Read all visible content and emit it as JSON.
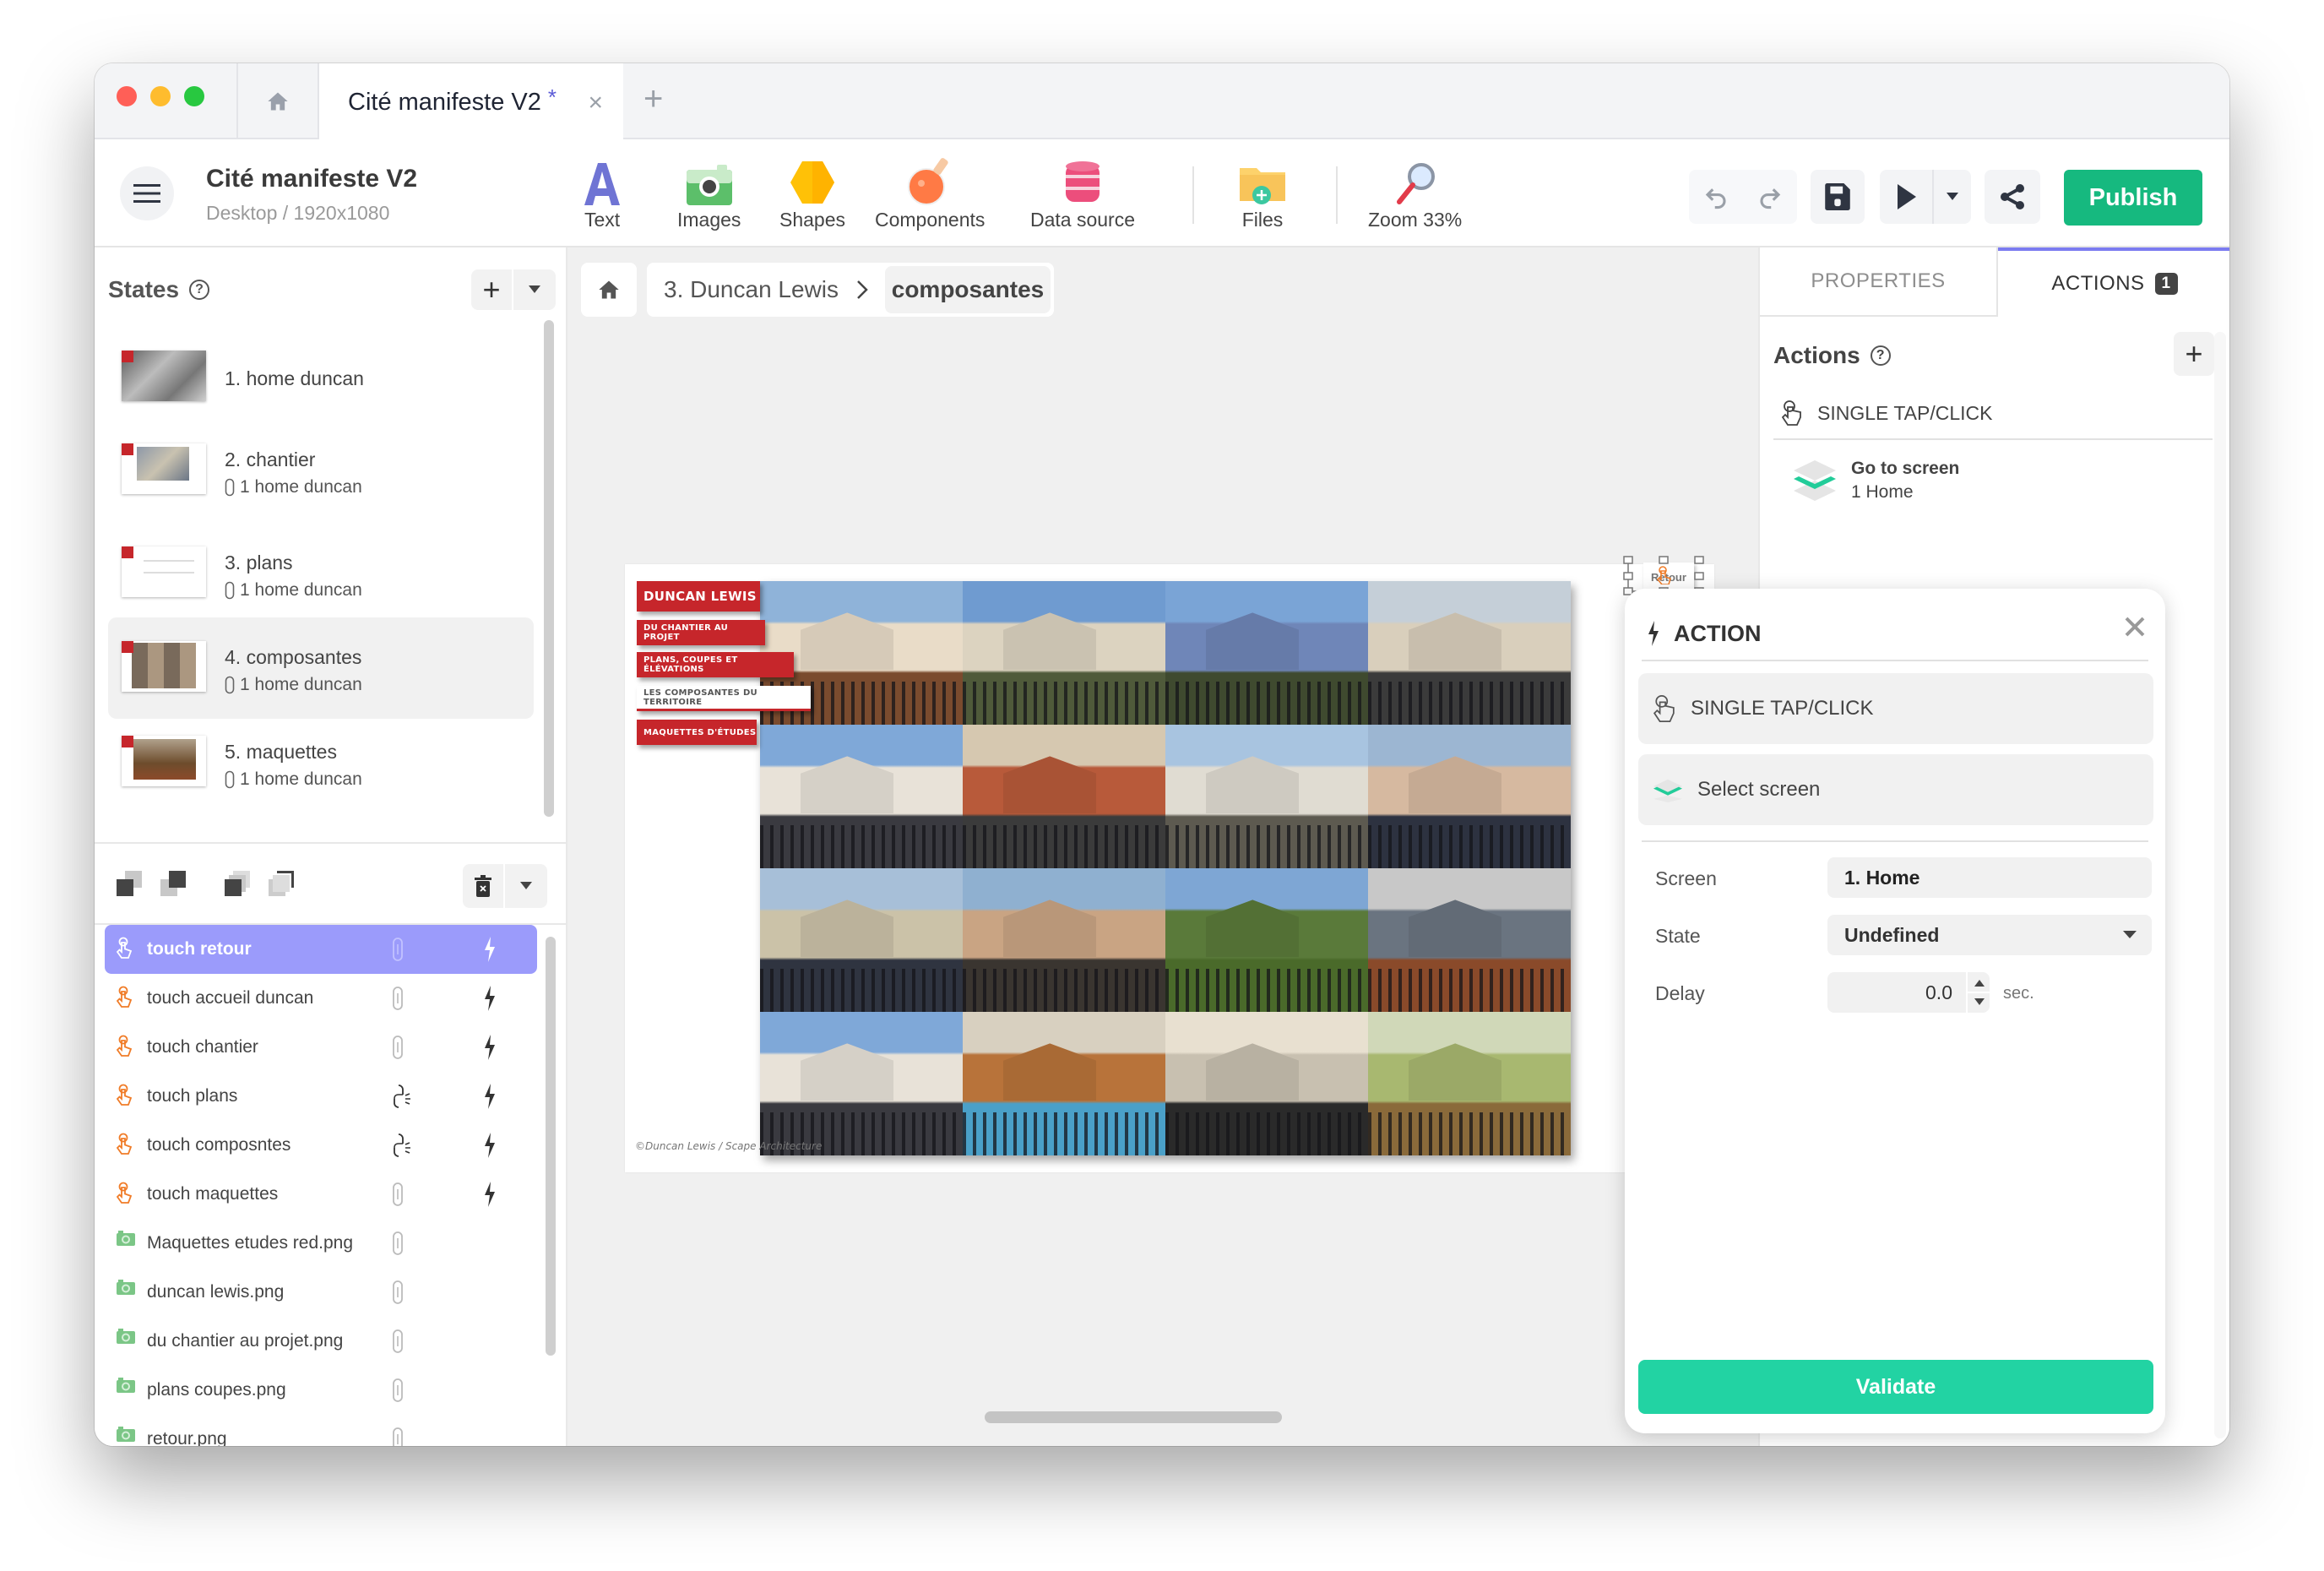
{
  "window": {
    "traffic_lights": {
      "close": "#ff5f57",
      "minimize": "#febc2e",
      "zoom": "#28c840"
    },
    "tabs": [
      {
        "label": "Cité manifeste V2",
        "modified_marker": "*",
        "active": true
      }
    ],
    "tab_close": "×",
    "tab_add": "+"
  },
  "toolbar": {
    "project_title": "Cité manifeste V2",
    "project_subtitle": "Desktop / 1920x1080",
    "tools": [
      {
        "label": "Text",
        "icon": "text-icon"
      },
      {
        "label": "Images",
        "icon": "camera-icon"
      },
      {
        "label": "Shapes",
        "icon": "hexagon-icon"
      },
      {
        "label": "Components",
        "icon": "flask-icon"
      },
      {
        "label": "Data source",
        "icon": "database-icon"
      },
      {
        "label": "Files",
        "icon": "folder-add-icon"
      },
      {
        "label": "Zoom 33%",
        "icon": "magnifier-icon"
      }
    ],
    "publish_label": "Publish",
    "colors": {
      "publish": "#16b97f",
      "accent": "#7b7bf0"
    }
  },
  "states_panel": {
    "title": "States",
    "items": [
      {
        "name": "1. home duncan",
        "link": null,
        "selected": false
      },
      {
        "name": "2. chantier",
        "link": "1  home duncan",
        "selected": false
      },
      {
        "name": "3. plans",
        "link": "1  home duncan",
        "selected": false
      },
      {
        "name": "4. composantes",
        "link": "1  home duncan",
        "selected": true
      },
      {
        "name": "5. maquettes",
        "link": "1  home duncan",
        "selected": false
      }
    ]
  },
  "layers": {
    "items": [
      {
        "name": "touch retour",
        "type": "hotspot",
        "link": "linked",
        "action": true,
        "selected": true
      },
      {
        "name": "touch accueil duncan",
        "type": "hotspot",
        "link": "linked",
        "action": true,
        "selected": false
      },
      {
        "name": "touch chantier",
        "type": "hotspot",
        "link": "linked",
        "action": true,
        "selected": false
      },
      {
        "name": "touch plans",
        "type": "hotspot",
        "link": "unlinked",
        "action": true,
        "selected": false
      },
      {
        "name": "touch composntes",
        "type": "hotspot",
        "link": "unlinked",
        "action": true,
        "selected": false
      },
      {
        "name": "touch maquettes",
        "type": "hotspot",
        "link": "linked",
        "action": true,
        "selected": false
      },
      {
        "name": "Maquettes etudes red.png",
        "type": "image",
        "link": "linked",
        "action": false,
        "selected": false
      },
      {
        "name": "duncan lewis.png",
        "type": "image",
        "link": "linked",
        "action": false,
        "selected": false
      },
      {
        "name": "du chantier au projet.png",
        "type": "image",
        "link": "linked",
        "action": false,
        "selected": false
      },
      {
        "name": "plans coupes.png",
        "type": "image",
        "link": "linked",
        "action": false,
        "selected": false
      },
      {
        "name": "retour.png",
        "type": "image",
        "link": "linked",
        "action": false,
        "selected": false
      }
    ]
  },
  "breadcrumb": {
    "items": [
      "3. Duncan Lewis",
      "composantes"
    ],
    "separator": "›"
  },
  "artboard": {
    "menu": [
      {
        "label": "DUNCAN LEWIS",
        "style": "red"
      },
      {
        "label": "DU CHANTIER AU PROJET",
        "style": "red"
      },
      {
        "label": "PLANS, COUPES ET ÉLÉVATIONS",
        "style": "red"
      },
      {
        "label": "LES COMPOSANTES DU TERRITOIRE",
        "style": "white"
      },
      {
        "label": "MAQUETTES D'ÉTUDES",
        "style": "red"
      }
    ],
    "copyright": "©Duncan Lewis / Scape Architecture",
    "retour_label": "Retour",
    "photo_count": 16
  },
  "right_panel": {
    "tabs": [
      {
        "label": "PROPERTIES",
        "active": false
      },
      {
        "label": "ACTIONS",
        "badge": "1",
        "active": true
      }
    ],
    "actions_title": "Actions",
    "trigger": "SINGLE TAP/CLICK",
    "action_title": "Go to screen",
    "action_target": "1 Home"
  },
  "action_popup": {
    "title": "ACTION",
    "trigger": "SINGLE TAP/CLICK",
    "action": "Select screen",
    "fields": {
      "screen_label": "Screen",
      "screen_value": "1. Home",
      "state_label": "State",
      "state_value": "Undefined",
      "delay_label": "Delay",
      "delay_value": "0.0",
      "delay_unit": "sec."
    },
    "validate_label": "Validate",
    "validate_color": "#22d3a3"
  }
}
